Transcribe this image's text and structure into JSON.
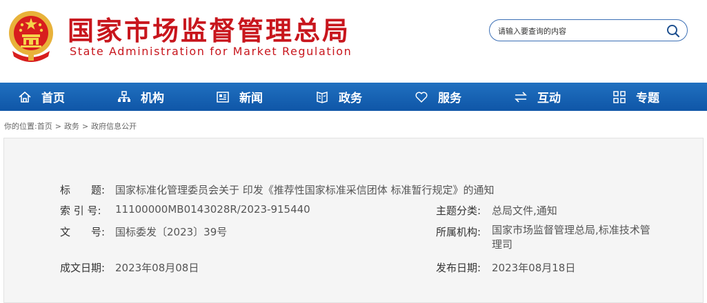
{
  "header": {
    "title_cn": "国家市场监督管理总局",
    "title_en": "State Administration for Market Regulation",
    "emblem_icon": "national-emblem-icon",
    "brand_color": "#c8161d"
  },
  "search": {
    "placeholder": "请输入要查询的内容",
    "icon": "search-icon"
  },
  "nav": {
    "background": "#1561b0",
    "items": [
      {
        "label": "首页",
        "icon": "home-icon"
      },
      {
        "label": "机构",
        "icon": "org-chart-icon"
      },
      {
        "label": "新闻",
        "icon": "news-icon"
      },
      {
        "label": "政务",
        "icon": "government-icon"
      },
      {
        "label": "服务",
        "icon": "heart-icon"
      },
      {
        "label": "互动",
        "icon": "exchange-icon"
      },
      {
        "label": "专题",
        "icon": "grid-icon"
      }
    ]
  },
  "breadcrumb": {
    "prefix": "你的位置:",
    "items": [
      "首页",
      "政务",
      "政府信息公开"
    ],
    "separator": ">"
  },
  "info": {
    "title_label": "标　　题:",
    "title_value": "国家标准化管理委员会关于 印发《推荐性国家标准采信团体 标准暂行规定》的通知",
    "index_label": "索 引 号:",
    "index_value": "11100000MB0143028R/2023-915440",
    "topic_label": "主题分类:",
    "topic_value": "总局文件,通知",
    "doc_label": "文　　号:",
    "doc_value": "国标委发〔2023〕39号",
    "org_label": "所属机构:",
    "org_value": "国家市场监督管理总局,标准技术管理司",
    "created_label": "成文日期:",
    "created_value": "2023年08月08日",
    "published_label": "发布日期:",
    "published_value": "2023年08月18日"
  }
}
